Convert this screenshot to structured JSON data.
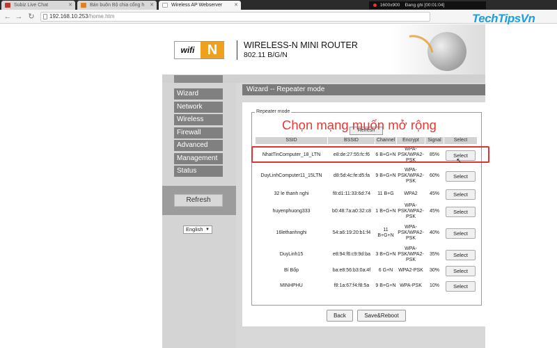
{
  "browser": {
    "tabs": [
      {
        "label": "Subiz Live Chat"
      },
      {
        "label": "Bán buôn Bộ chia cổng h"
      },
      {
        "label": "Wireless AP Webserver"
      }
    ],
    "recording": {
      "resolution": "1600x900",
      "status": "Đang ghi [00:01:04]"
    },
    "url_host": "192.168.10.253",
    "url_path": "/home.htm",
    "brand": "TechTipsVn"
  },
  "header": {
    "logo_wifi": "wifi",
    "logo_n": "N",
    "product_line1": "WIRELESS-N MINI ROUTER",
    "product_line2": "802.11 B/G/N"
  },
  "sidebar": {
    "items": [
      "Wizard",
      "Network",
      "Wireless",
      "Firewall",
      "Advanced",
      "Management",
      "Status"
    ],
    "refresh_label": "Refresh",
    "language": "English"
  },
  "main": {
    "title": "Wizard -- Repeater mode",
    "legend": "Repeater mode",
    "refresh_label": "Refresh",
    "overlay": "Chọn mạng muốn mở rộng",
    "columns": [
      "SSID",
      "BSSID",
      "Channel",
      "Encrypt",
      "Signal",
      "Select"
    ],
    "rows": [
      {
        "ssid": "NhatTinComputer_18_LTN",
        "bssid": "e8:de:27:55:fc:f6",
        "channel": "6 B+G+N",
        "encrypt": "WPA-PSK/WPA2-PSK",
        "signal": "85%",
        "select": "Select"
      },
      {
        "ssid": "DuyLinhComputer11_15LTN",
        "bssid": "d8:5d:4c:fe:d5:fa",
        "channel": "9 B+G+N",
        "encrypt": "WPA-PSK/WPA2-PSK",
        "signal": "60%",
        "select": "Select"
      },
      {
        "ssid": "32 le thanh nghi",
        "bssid": "f8:d1:11:33:6d:74",
        "channel": "11 B+G",
        "encrypt": "WPA2",
        "signal": "45%",
        "select": "Select"
      },
      {
        "ssid": "huyenphuong333",
        "bssid": "b0:48:7a:a0:32:c8",
        "channel": "1 B+G+N",
        "encrypt": "WPA-PSK/WPA2-PSK",
        "signal": "45%",
        "select": "Select"
      },
      {
        "ssid": "16lethanhnghi",
        "bssid": "54:a6:19:20:b1:f4",
        "channel": "11 B+G+N",
        "encrypt": "WPA-PSK/WPA2-PSK",
        "signal": "40%",
        "select": "Select"
      },
      {
        "ssid": "DuyLinh15",
        "bssid": "e8:94:f6:c9:9d:ba",
        "channel": "3 B+G+N",
        "encrypt": "WPA-PSK/WPA2-PSK",
        "signal": "35%",
        "select": "Select"
      },
      {
        "ssid": "Bí Bốp",
        "bssid": "ba:e8:56:b3:0a:4f",
        "channel": "6 G+N",
        "encrypt": "WPA2-PSK",
        "signal": "30%",
        "select": "Select"
      },
      {
        "ssid": "MINHPHU",
        "bssid": "f8:1a:67:f4:f8:5a",
        "channel": "9 B+G+N",
        "encrypt": "WPA-PSK",
        "signal": "10%",
        "select": "Select"
      }
    ],
    "back_label": "Back",
    "save_label": "Save&Reboot"
  },
  "colors": {
    "accent": "#f0a11c",
    "highlight": "#e03131",
    "overlay_text": "#e53935",
    "menu_bg": "#808080"
  }
}
